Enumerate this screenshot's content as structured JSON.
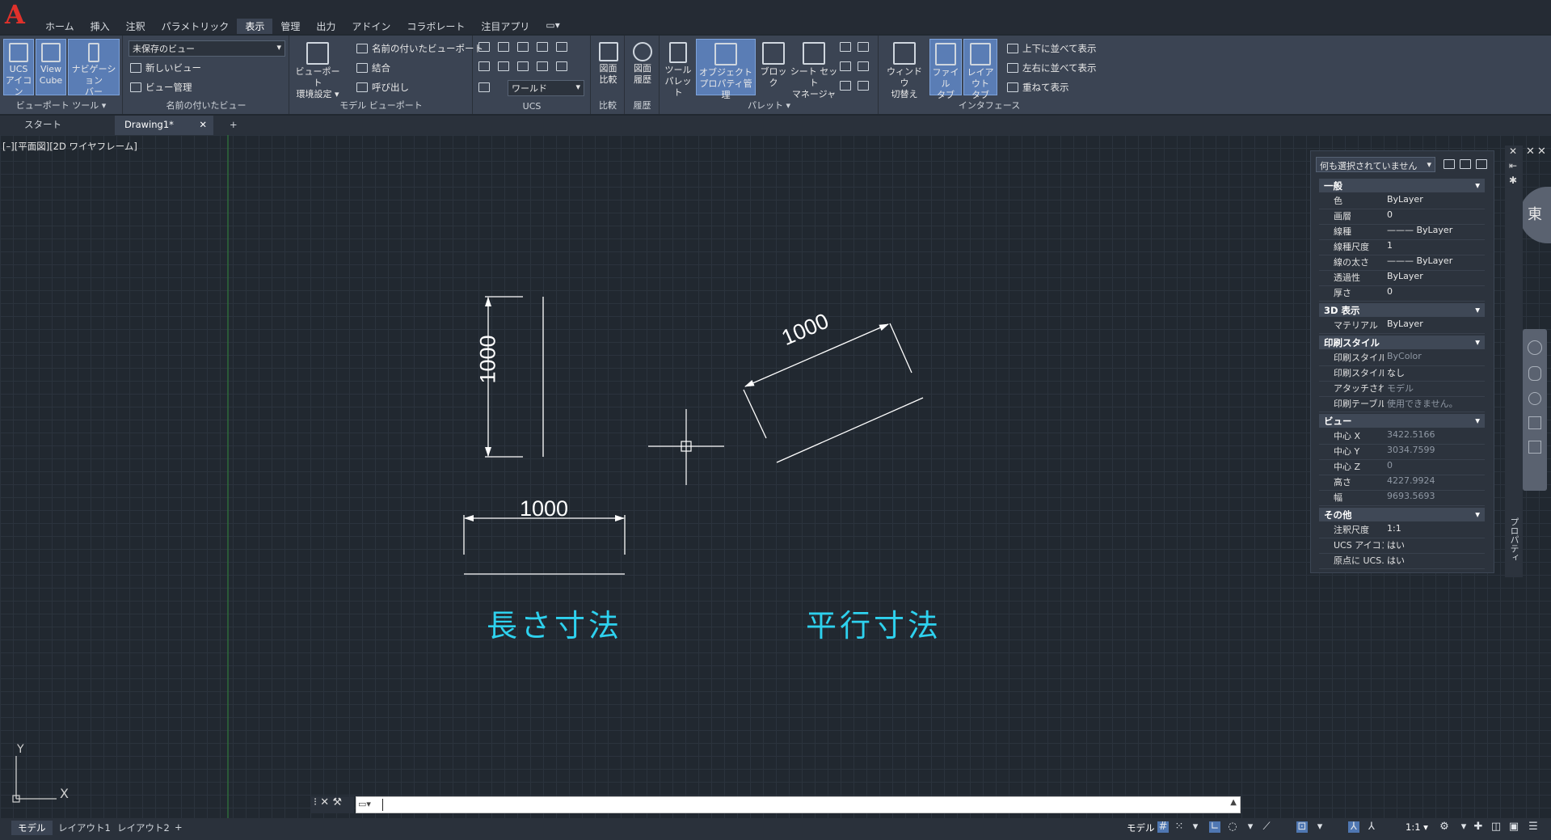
{
  "app": {
    "logo": "A"
  },
  "menu_tabs": [
    "ホーム",
    "挿入",
    "注釈",
    "パラメトリック",
    "表示",
    "管理",
    "出力",
    "アドイン",
    "コラボレート",
    "注目アプリ",
    "▭▾"
  ],
  "menu_active": "表示",
  "ribbon": {
    "viewport_tools": {
      "ucs": "UCS\nアイコン",
      "viewcube": "View\nCube",
      "navbar": "ナビゲーション\nバー",
      "title": "ビューポート ツール ▾"
    },
    "named_views": {
      "dropdown": "未保存のビュー",
      "new": "新しいビュー",
      "manager": "ビュー管理",
      "title": "名前の付いたビュー"
    },
    "model_viewports": {
      "config": "ビューポート\n環境設定 ▾",
      "named": "名前の付いたビューポート",
      "join": "結合",
      "restore": "呼び出し",
      "title": "モデル ビューポート"
    },
    "ucs": {
      "world": "ワールド",
      "title": "UCS"
    },
    "compare": {
      "label": "図面\n比較",
      "title": "比較"
    },
    "history": {
      "label": "図面\n履歴",
      "title": "履歴"
    },
    "palettes": {
      "tool": "ツール\nパレット",
      "props": "オブジェクト\nプロパティ管理",
      "block": "ブロック",
      "sheetset": "シート セット\nマネージャ",
      "title": "パレット ▾"
    },
    "interface": {
      "switch": "ウィンドウ\n切替え",
      "filetab": "ファイル\nタブ",
      "layouttab": "レイアウト\nタブ",
      "tile_h": "上下に並べて表示",
      "tile_v": "左右に並べて表示",
      "cascade": "重ねて表示",
      "title": "インタフェース"
    }
  },
  "doc_tabs": {
    "start": "スタート",
    "drawing": "Drawing1*",
    "close": "✕",
    "add": "+"
  },
  "viewport": {
    "label": "[–][平面図][2D ワイヤフレーム]"
  },
  "drawing": {
    "dim_vertical": "1000",
    "dim_aligned": "1000",
    "dim_horizontal": "1000",
    "label_linear": "長さ寸法",
    "label_aligned": "平行寸法",
    "ucs_x": "X",
    "ucs_y": "Y"
  },
  "properties": {
    "selection": "何も選択されていません",
    "sections": {
      "general": "一般",
      "display3d": "3D 表示",
      "plotstyle": "印刷スタイル",
      "view": "ビュー",
      "misc": "その他"
    },
    "general": [
      [
        "色",
        "ByLayer"
      ],
      [
        "画層",
        "0"
      ],
      [
        "線種",
        "——— ByLayer"
      ],
      [
        "線種尺度",
        "1"
      ],
      [
        "線の太さ",
        "——— ByLayer"
      ],
      [
        "透過性",
        "ByLayer"
      ],
      [
        "厚さ",
        "0"
      ]
    ],
    "display3d": [
      [
        "マテリアル",
        "ByLayer"
      ]
    ],
    "plotstyle": [
      [
        "印刷スタイル",
        "ByColor"
      ],
      [
        "印刷スタイル...",
        "なし"
      ],
      [
        "アタッチされた...",
        "モデル"
      ],
      [
        "印刷テーブル...",
        "使用できません。"
      ]
    ],
    "view": [
      [
        "中心 X",
        "3422.5166"
      ],
      [
        "中心 Y",
        "3034.7599"
      ],
      [
        "中心 Z",
        "0"
      ],
      [
        "高さ",
        "4227.9924"
      ],
      [
        "幅",
        "9693.5693"
      ]
    ],
    "misc": [
      [
        "注釈尺度",
        "1:1"
      ],
      [
        "UCS アイコン...",
        "はい"
      ],
      [
        "原点に UCS...",
        "はい"
      ]
    ],
    "side_label": "プロパティ",
    "compass": "東"
  },
  "layout_tabs": [
    "モデル",
    "レイアウト1",
    "レイアウト2",
    "+"
  ],
  "status": {
    "model": "モデル",
    "scale": "1:1 ▾"
  }
}
